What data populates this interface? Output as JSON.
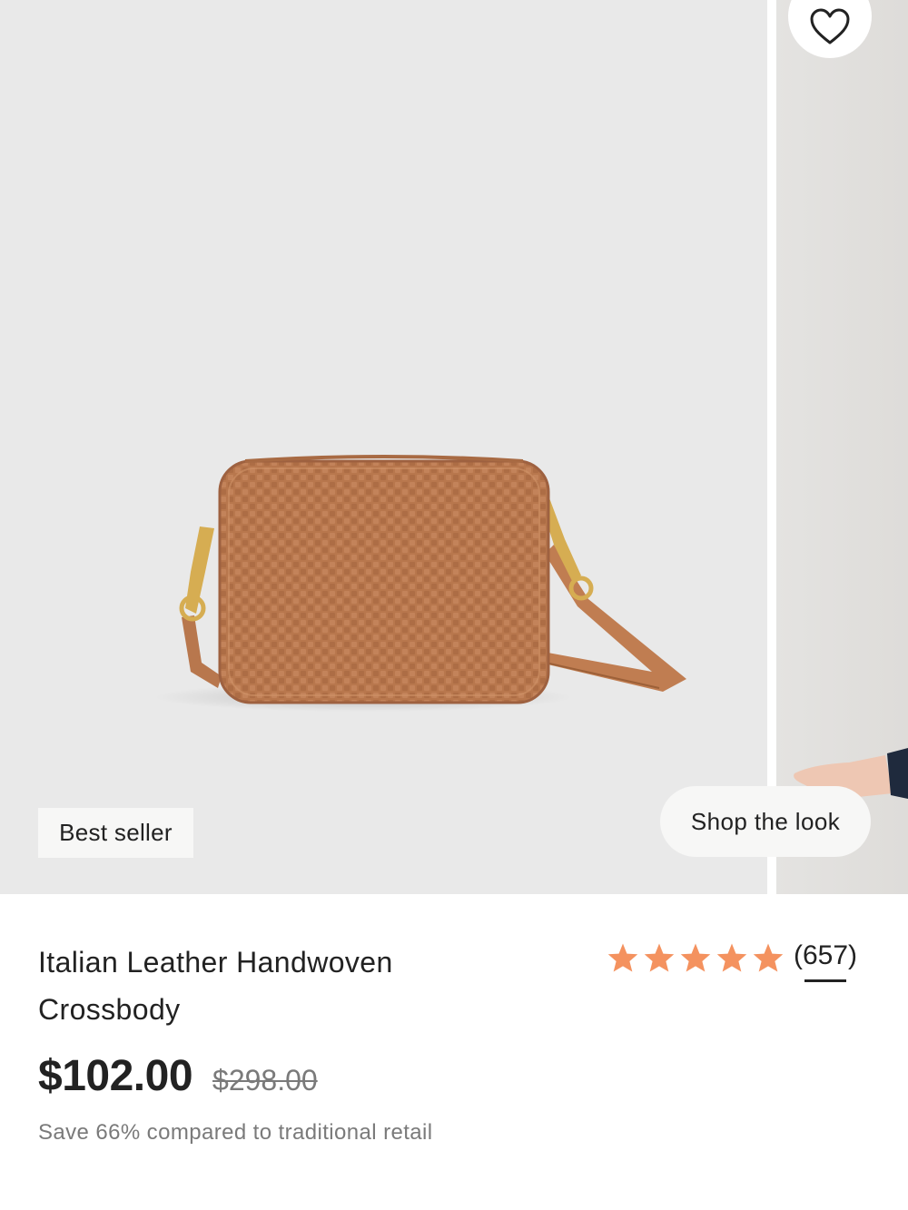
{
  "gallery": {
    "badge_label": "Best seller",
    "shop_the_look_label": "Shop the look",
    "favorite_icon": "heart-outline-icon"
  },
  "product": {
    "title": "Italian Leather Handwoven Crossbody",
    "rating_value": 5,
    "rating_max": 5,
    "review_count": "(657)",
    "price": "$102.00",
    "compare_price": "$298.00",
    "savings_text": "Save 66% compared to traditional retail"
  },
  "colors": {
    "star": "#f4925f",
    "bag_leather": "#b8774d",
    "text_primary": "#222222",
    "text_muted": "#7a7a7a",
    "image_bg": "#e9e9e9"
  }
}
